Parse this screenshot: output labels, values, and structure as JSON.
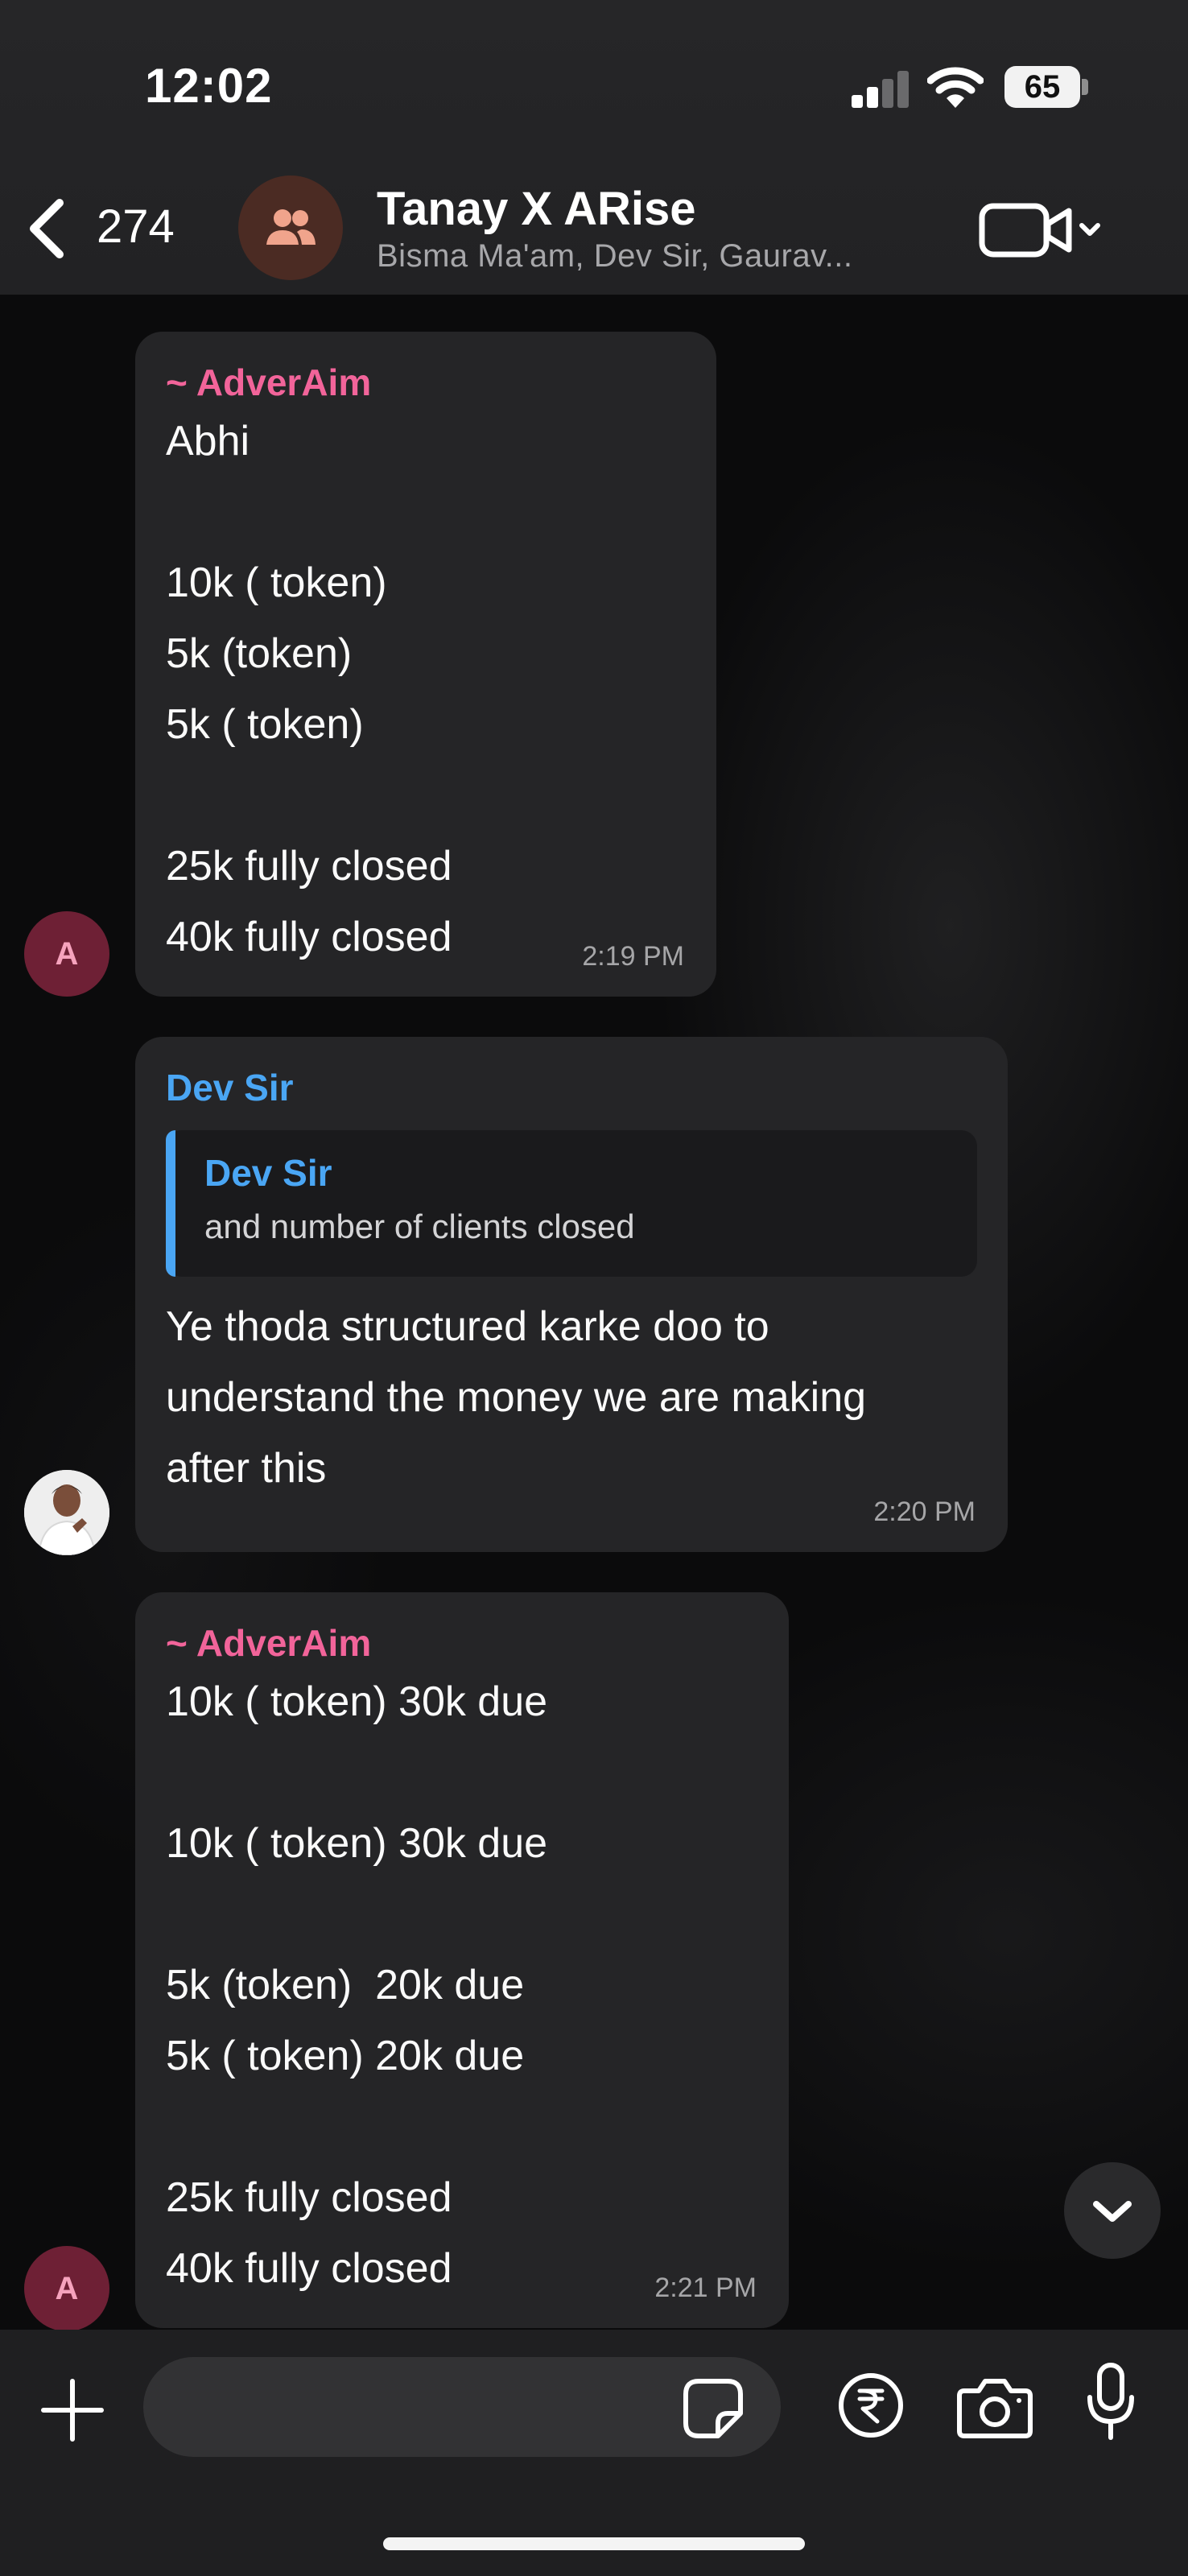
{
  "status_bar": {
    "time": "12:02",
    "battery": "65",
    "icons": [
      "signal-icon",
      "wifi-icon",
      "battery-icon"
    ]
  },
  "header": {
    "back_count": "274",
    "title": "Tanay X ARise",
    "subtitle": "Bisma Ma'am, Dev Sir, Gaurav...",
    "icons": [
      "back-chevron-icon",
      "group-icon",
      "video-call-icon",
      "chevron-down-icon"
    ]
  },
  "messages": [
    {
      "sender": "~ AdverAim",
      "avatar_letter": "A",
      "text": "Abhi\n\n10k ( token)\n5k (token)\n5k ( token)\n\n25k fully closed\n40k fully closed",
      "time": "2:19 PM"
    },
    {
      "sender": "Dev Sir",
      "quote": {
        "name": "Dev Sir",
        "text": "and number of clients closed"
      },
      "text": "Ye thoda structured karke doo to\nunderstand the money we are making\nafter this",
      "time": "2:20 PM"
    },
    {
      "sender": "~ AdverAim",
      "avatar_letter": "A",
      "text": "10k ( token) 30k due\n\n10k ( token) 30k due\n\n5k (token)  20k due\n5k ( token) 20k due\n\n25k fully closed\n40k fully closed",
      "time": "2:21 PM"
    }
  ],
  "composer": {
    "input_value": "",
    "icons": [
      "plus-icon",
      "sticker-icon",
      "rupee-payment-icon",
      "camera-icon",
      "microphone-icon"
    ]
  },
  "colors": {
    "header_bg": "#262628",
    "bubble_bg": "#252527",
    "adveraim_name": "#f2649a",
    "devsir_name": "#4aa6f4",
    "avatar_a_bg": "#6e2035"
  }
}
